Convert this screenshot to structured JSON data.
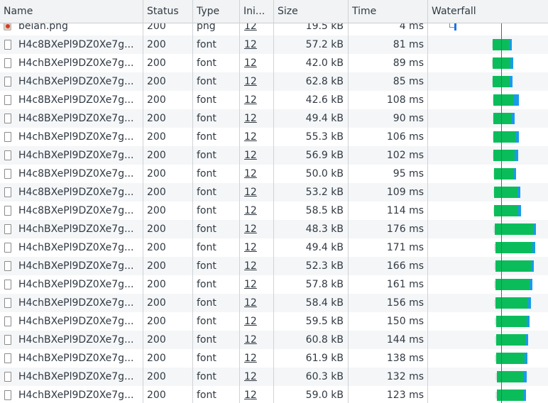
{
  "columns": {
    "name": "Name",
    "status": "Status",
    "type": "Type",
    "initiator": "Ini...",
    "size": "Size",
    "time": "Time",
    "waterfall": "Waterfall"
  },
  "rows": [
    {
      "name": "beian.png",
      "status": "200",
      "type": "png",
      "initiator": "12",
      "size": "19.5 kB",
      "time": "4 ms",
      "icon": "png-image-icon"
    },
    {
      "name": "H4c8BXePl9DZ0Xe7g...",
      "status": "200",
      "type": "font",
      "initiator": "12",
      "size": "57.2 kB",
      "time": "81 ms",
      "icon": "file-icon"
    },
    {
      "name": "H4chBXePl9DZ0Xe7g...",
      "status": "200",
      "type": "font",
      "initiator": "12",
      "size": "42.0 kB",
      "time": "89 ms",
      "icon": "file-icon"
    },
    {
      "name": "H4chBXePl9DZ0Xe7g...",
      "status": "200",
      "type": "font",
      "initiator": "12",
      "size": "62.8 kB",
      "time": "85 ms",
      "icon": "file-icon"
    },
    {
      "name": "H4c8BXePl9DZ0Xe7g...",
      "status": "200",
      "type": "font",
      "initiator": "12",
      "size": "42.6 kB",
      "time": "108 ms",
      "icon": "file-icon"
    },
    {
      "name": "H4c8BXePl9DZ0Xe7g...",
      "status": "200",
      "type": "font",
      "initiator": "12",
      "size": "49.4 kB",
      "time": "90 ms",
      "icon": "file-icon"
    },
    {
      "name": "H4chBXePl9DZ0Xe7g...",
      "status": "200",
      "type": "font",
      "initiator": "12",
      "size": "55.3 kB",
      "time": "106 ms",
      "icon": "file-icon"
    },
    {
      "name": "H4chBXePl9DZ0Xe7g...",
      "status": "200",
      "type": "font",
      "initiator": "12",
      "size": "56.9 kB",
      "time": "102 ms",
      "icon": "file-icon"
    },
    {
      "name": "H4c8BXePl9DZ0Xe7g...",
      "status": "200",
      "type": "font",
      "initiator": "12",
      "size": "50.0 kB",
      "time": "95 ms",
      "icon": "file-icon"
    },
    {
      "name": "H4c8BXePl9DZ0Xe7g...",
      "status": "200",
      "type": "font",
      "initiator": "12",
      "size": "53.2 kB",
      "time": "109 ms",
      "icon": "file-icon"
    },
    {
      "name": "H4c8BXePl9DZ0Xe7g...",
      "status": "200",
      "type": "font",
      "initiator": "12",
      "size": "58.5 kB",
      "time": "114 ms",
      "icon": "file-icon"
    },
    {
      "name": "H4chBXePl9DZ0Xe7g...",
      "status": "200",
      "type": "font",
      "initiator": "12",
      "size": "48.3 kB",
      "time": "176 ms",
      "icon": "file-icon"
    },
    {
      "name": "H4chBXePl9DZ0Xe7g...",
      "status": "200",
      "type": "font",
      "initiator": "12",
      "size": "49.4 kB",
      "time": "171 ms",
      "icon": "file-icon"
    },
    {
      "name": "H4chBXePl9DZ0Xe7g...",
      "status": "200",
      "type": "font",
      "initiator": "12",
      "size": "52.3 kB",
      "time": "166 ms",
      "icon": "file-icon"
    },
    {
      "name": "H4chBXePl9DZ0Xe7g...",
      "status": "200",
      "type": "font",
      "initiator": "12",
      "size": "57.8 kB",
      "time": "161 ms",
      "icon": "file-icon"
    },
    {
      "name": "H4chBXePl9DZ0Xe7g...",
      "status": "200",
      "type": "font",
      "initiator": "12",
      "size": "58.4 kB",
      "time": "156 ms",
      "icon": "file-icon"
    },
    {
      "name": "H4chBXePl9DZ0Xe7g...",
      "status": "200",
      "type": "font",
      "initiator": "12",
      "size": "59.5 kB",
      "time": "150 ms",
      "icon": "file-icon"
    },
    {
      "name": "H4chBXePl9DZ0Xe7g...",
      "status": "200",
      "type": "font",
      "initiator": "12",
      "size": "60.8 kB",
      "time": "144 ms",
      "icon": "file-icon"
    },
    {
      "name": "H4chBXePl9DZ0Xe7g...",
      "status": "200",
      "type": "font",
      "initiator": "12",
      "size": "61.9 kB",
      "time": "138 ms",
      "icon": "file-icon"
    },
    {
      "name": "H4chBXePl9DZ0Xe7g...",
      "status": "200",
      "type": "font",
      "initiator": "12",
      "size": "60.3 kB",
      "time": "132 ms",
      "icon": "file-icon"
    },
    {
      "name": "H4chBXePl9DZ0Xe7g...",
      "status": "200",
      "type": "font",
      "initiator": "12",
      "size": "59.0 kB",
      "time": "123 ms",
      "icon": "file-icon"
    }
  ],
  "colors": {
    "header_bg": "#f1f3f4",
    "row_alt_bg": "#f4f6f8",
    "waterfall_download": "#0bbd5a",
    "waterfall_receive": "#1a9bea",
    "dom_content_loaded_line": "#2b6fb6"
  }
}
